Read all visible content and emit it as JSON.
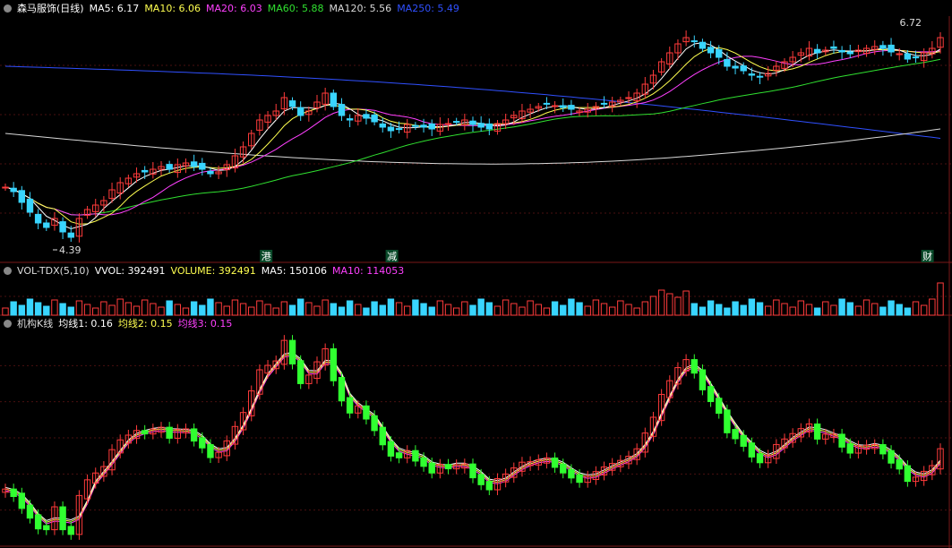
{
  "stock": {
    "name": "森马服饰",
    "period": "(日线)"
  },
  "colors": {
    "up": "#ff3b3b",
    "down": "#39d5ff",
    "bg": "#000000",
    "grid": "#4a1010",
    "ma5": "#ffffff",
    "ma10": "#ffff50",
    "ma20": "#ff40ff",
    "ma60": "#30e030",
    "ma120": "#d8d8d8",
    "ma250": "#3050ff"
  },
  "price_panel": {
    "ma_labels": [
      {
        "name": "MA5",
        "value": "6.17",
        "color": "#ffffff"
      },
      {
        "name": "MA10",
        "value": "6.06",
        "color": "#ffff50"
      },
      {
        "name": "MA20",
        "value": "6.03",
        "color": "#ff40ff"
      },
      {
        "name": "MA60",
        "value": "5.88",
        "color": "#30e030"
      },
      {
        "name": "MA120",
        "value": "5.56",
        "color": "#d8d8d8"
      },
      {
        "name": "MA250",
        "value": "5.49",
        "color": "#3050ff"
      }
    ],
    "high_label": "6.72",
    "low_label": "4.39",
    "markers": [
      {
        "text": "港",
        "pos": 0.28
      },
      {
        "text": "减",
        "pos": 0.415
      },
      {
        "text": "财",
        "pos": 0.99
      }
    ]
  },
  "volume_panel": {
    "indicator": "VOL-TDX(5,10)",
    "labels": [
      {
        "name": "VVOL",
        "value": "392491",
        "color": "#ffffff"
      },
      {
        "name": "VOLUME",
        "value": "392491",
        "color": "#ffff50"
      },
      {
        "name": "MA5",
        "value": "150106",
        "color": "#ffffff"
      },
      {
        "name": "MA10",
        "value": "114053",
        "color": "#ff40ff"
      }
    ]
  },
  "jigou_panel": {
    "indicator": "机构K线",
    "labels": [
      {
        "name": "均线1",
        "value": "0.16",
        "color": "#ffffff"
      },
      {
        "name": "均线2",
        "value": "0.15",
        "color": "#ffff50"
      },
      {
        "name": "均线3",
        "value": "0.15",
        "color": "#ff40ff"
      }
    ]
  },
  "chart_data": {
    "type": "candlestick",
    "price_range": [
      4.39,
      6.72
    ],
    "close": [
      4.95,
      4.9,
      4.78,
      4.67,
      4.55,
      4.5,
      4.6,
      4.45,
      4.39,
      4.6,
      4.7,
      4.75,
      4.8,
      4.92,
      5.0,
      5.05,
      5.1,
      5.12,
      5.15,
      5.18,
      5.15,
      5.2,
      5.22,
      5.18,
      5.15,
      5.1,
      5.12,
      5.2,
      5.3,
      5.4,
      5.55,
      5.7,
      5.75,
      5.8,
      5.95,
      5.85,
      5.75,
      5.8,
      5.9,
      6.0,
      5.85,
      5.75,
      5.7,
      5.75,
      5.72,
      5.68,
      5.62,
      5.58,
      5.6,
      5.65,
      5.63,
      5.62,
      5.6,
      5.65,
      5.66,
      5.68,
      5.7,
      5.65,
      5.62,
      5.6,
      5.66,
      5.7,
      5.75,
      5.8,
      5.82,
      5.85,
      5.88,
      5.86,
      5.84,
      5.82,
      5.8,
      5.82,
      5.85,
      5.88,
      5.9,
      5.92,
      5.95,
      6.0,
      6.1,
      6.2,
      6.35,
      6.45,
      6.55,
      6.62,
      6.58,
      6.5,
      6.45,
      6.4,
      6.3,
      6.28,
      6.25,
      6.2,
      6.18,
      6.22,
      6.3,
      6.35,
      6.4,
      6.45,
      6.5,
      6.45,
      6.48,
      6.5,
      6.46,
      6.44,
      6.48,
      6.5,
      6.52,
      6.5,
      6.46,
      6.44,
      6.38,
      6.4,
      6.45,
      6.5,
      6.62
    ]
  }
}
